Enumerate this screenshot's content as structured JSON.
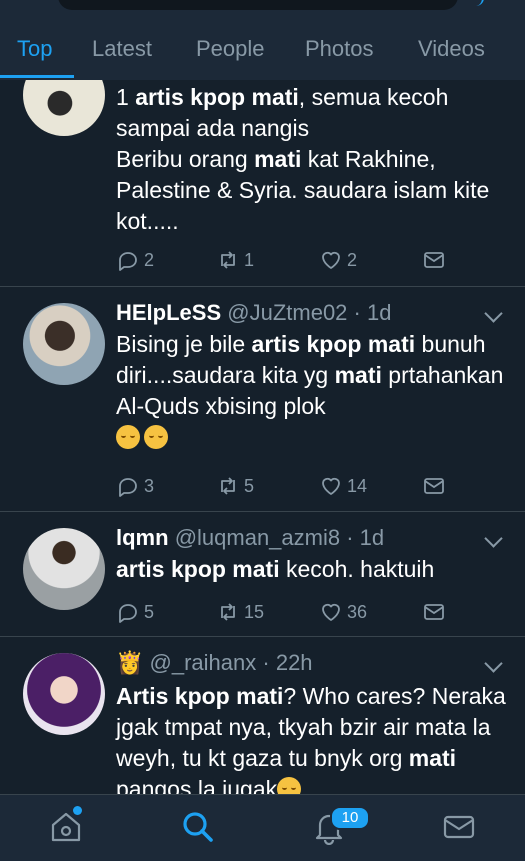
{
  "tabs": [
    "Top",
    "Latest",
    "People",
    "Photos",
    "Videos"
  ],
  "tweets": [
    {
      "body": [
        {
          "t": "1 "
        },
        {
          "t": "artis kpop mati",
          "b": true
        },
        {
          "t": ", semua kecoh sampai ada nangis"
        },
        {
          "br": true
        },
        {
          "t": "Beribu orang "
        },
        {
          "t": "mati",
          "b": true
        },
        {
          "t": " kat Rakhine, Palestine & Syria. saudara islam kite kot....."
        }
      ],
      "replies": "2",
      "retweets": "1",
      "likes": "2"
    },
    {
      "name": "HElpLeSS",
      "handle": "@JuZtme02",
      "time": "1d",
      "body": [
        {
          "t": "Bising je bile "
        },
        {
          "t": "artis kpop mati",
          "b": true
        },
        {
          "t": " bunuh diri....saudara kita yg "
        },
        {
          "t": "mati",
          "b": true
        },
        {
          "t": " prtahankan Al-Quds xbising plok"
        },
        {
          "br": true
        },
        {
          "emoji": true
        },
        {
          "emoji": true
        }
      ],
      "replies": "3",
      "retweets": "5",
      "likes": "14"
    },
    {
      "name": "lqmn",
      "handle": "@luqman_azmi8",
      "time": "1d",
      "body": [
        {
          "t": "artis kpop mati",
          "b": true
        },
        {
          "t": " kecoh. haktuih"
        }
      ],
      "replies": "5",
      "retweets": "15",
      "likes": "36"
    },
    {
      "name": "👸",
      "handle": "@_raihanx",
      "time": "22h",
      "body": [
        {
          "t": "Artis kpop mati",
          "b": true
        },
        {
          "t": "? Who cares? Neraka jgak tmpat nya, tkyah bzir air mata la weyh, tu kt gaza tu bnyk org "
        },
        {
          "t": "mati",
          "b": true
        },
        {
          "t": " pangos la jugak"
        },
        {
          "emoji": true
        }
      ]
    }
  ],
  "notifications_badge": "10",
  "colors": {
    "accent": "#1da1f2",
    "background": "#15202b",
    "bar": "#1c2938",
    "muted": "#8899a6"
  },
  "icons": [
    "reply-icon",
    "retweet-icon",
    "like-icon",
    "dm-icon",
    "home-icon",
    "search-icon",
    "notifications-icon",
    "messages-icon"
  ]
}
